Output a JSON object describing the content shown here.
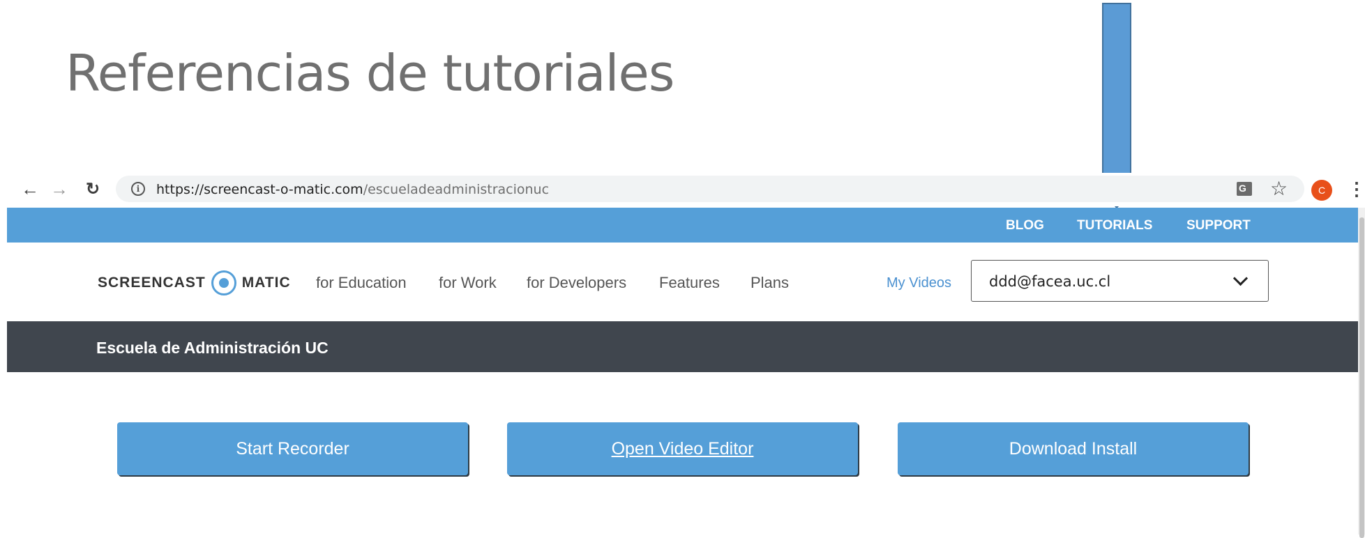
{
  "slide": {
    "title": "Referencias de tutoriales"
  },
  "browser": {
    "url_host": "https://screencast-o-matic.com",
    "url_path": "/escueladeadministracionuc",
    "profile_initial": "C",
    "icons": [
      "back-arrow-icon",
      "forward-arrow-icon",
      "reload-icon",
      "info-icon",
      "translate-icon",
      "star-icon",
      "profile-icon",
      "menu-icon"
    ]
  },
  "topbar": {
    "blog": "BLOG",
    "tutorials": "TUTORIALS",
    "support": "SUPPORT"
  },
  "nav": {
    "logo_left": "SCREENCAST",
    "logo_right": "MATIC",
    "items": [
      "for Education",
      "for Work",
      "for Developers",
      "Features",
      "Plans"
    ],
    "my_videos": "My Videos",
    "account": "ddd@facea.uc.cl"
  },
  "org": {
    "name": "Escuela de Administración UC"
  },
  "actions": {
    "start": "Start Recorder",
    "editor": "Open Video Editor",
    "download": "Download Install"
  },
  "colors": {
    "brand_blue": "#559fd8",
    "band_dark": "#40464e",
    "arrow_blue": "#5b9bd5",
    "arrow_border": "#41719c"
  }
}
